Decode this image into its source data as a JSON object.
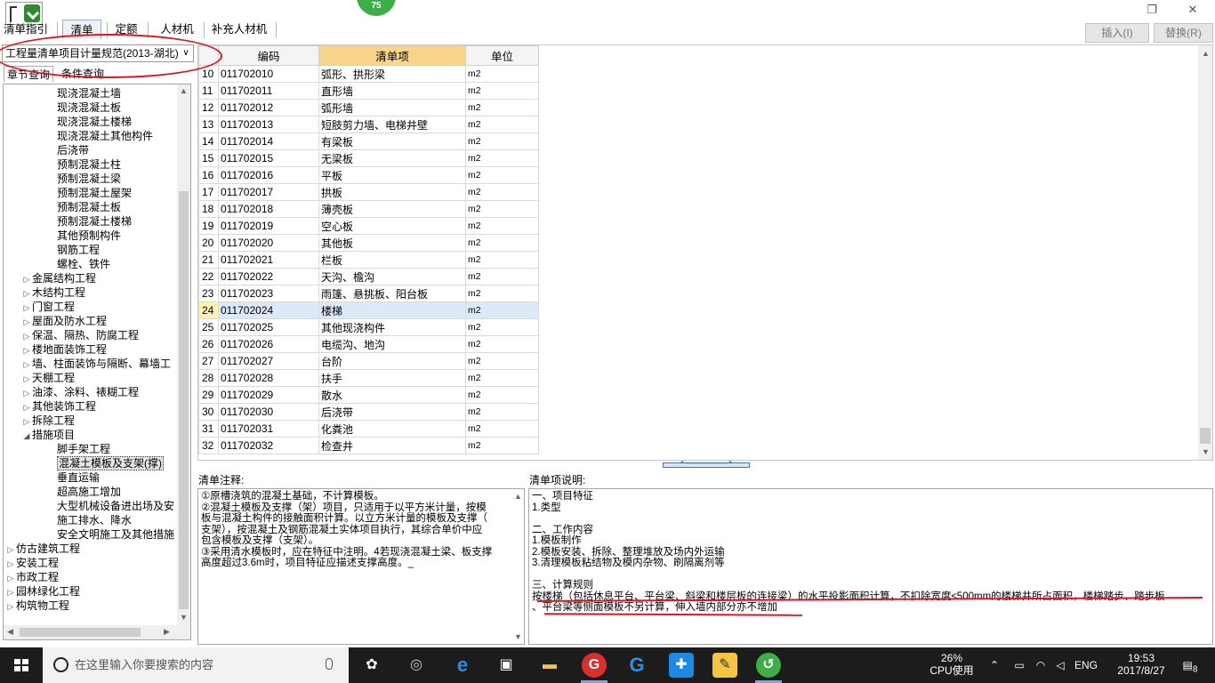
{
  "window": {
    "badge": "75",
    "restore_glyph": "❐",
    "close_glyph": "✕"
  },
  "tabs": [
    "清单指引",
    "清单",
    "定额",
    "人材机",
    "补充人材机"
  ],
  "toolbar": {
    "insert": "插入(I)",
    "replace": "替换(R)"
  },
  "left": {
    "spec_select": "工程量清单项目计量规范(2013-湖北)",
    "search_tabs": [
      "章节查询",
      "条件查询"
    ],
    "tree": [
      {
        "label": "现浇混凝土墙",
        "level": 3
      },
      {
        "label": "现浇混凝土板",
        "level": 3
      },
      {
        "label": "现浇混凝土楼梯",
        "level": 3
      },
      {
        "label": "现浇混凝土其他构件",
        "level": 3
      },
      {
        "label": "后浇带",
        "level": 3
      },
      {
        "label": "预制混凝土柱",
        "level": 3
      },
      {
        "label": "预制混凝土梁",
        "level": 3
      },
      {
        "label": "预制混凝土屋架",
        "level": 3
      },
      {
        "label": "预制混凝土板",
        "level": 3
      },
      {
        "label": "预制混凝土楼梯",
        "level": 3
      },
      {
        "label": "其他预制构件",
        "level": 3
      },
      {
        "label": "钢筋工程",
        "level": 3
      },
      {
        "label": "螺栓、铁件",
        "level": 3
      },
      {
        "label": "金属结构工程",
        "level": 2,
        "toggle": "▷"
      },
      {
        "label": "木结构工程",
        "level": 2,
        "toggle": "▷"
      },
      {
        "label": "门窗工程",
        "level": 2,
        "toggle": "▷"
      },
      {
        "label": "屋面及防水工程",
        "level": 2,
        "toggle": "▷"
      },
      {
        "label": "保温、隔热、防腐工程",
        "level": 2,
        "toggle": "▷"
      },
      {
        "label": "楼地面装饰工程",
        "level": 2,
        "toggle": "▷"
      },
      {
        "label": "墙、柱面装饰与隔断、幕墙工",
        "level": 2,
        "toggle": "▷"
      },
      {
        "label": "天棚工程",
        "level": 2,
        "toggle": "▷"
      },
      {
        "label": "油漆、涂料、裱糊工程",
        "level": 2,
        "toggle": "▷"
      },
      {
        "label": "其他装饰工程",
        "level": 2,
        "toggle": "▷"
      },
      {
        "label": "拆除工程",
        "level": 2,
        "toggle": "▷"
      },
      {
        "label": "措施项目",
        "level": 2,
        "toggle": "◢"
      },
      {
        "label": "脚手架工程",
        "level": 3
      },
      {
        "label": "混凝土模板及支架(撑)",
        "level": 3,
        "selected": true
      },
      {
        "label": "垂直运输",
        "level": 3
      },
      {
        "label": "超高施工增加",
        "level": 3
      },
      {
        "label": "大型机械设备进出场及安",
        "level": 3
      },
      {
        "label": "施工排水、降水",
        "level": 3
      },
      {
        "label": "安全文明施工及其他措施",
        "level": 3
      },
      {
        "label": "仿古建筑工程",
        "level": 1,
        "toggle": "▷"
      },
      {
        "label": "安装工程",
        "level": 1,
        "toggle": "▷"
      },
      {
        "label": "市政工程",
        "level": 1,
        "toggle": "▷"
      },
      {
        "label": "园林绿化工程",
        "level": 1,
        "toggle": "▷"
      },
      {
        "label": "构筑物工程",
        "level": 1,
        "toggle": "▷"
      }
    ]
  },
  "grid": {
    "headers": [
      "",
      "编码",
      "清单项",
      "单位"
    ],
    "rows": [
      [
        "10",
        "011702010",
        "弧形、拱形梁",
        "m2"
      ],
      [
        "11",
        "011702011",
        "直形墙",
        "m2"
      ],
      [
        "12",
        "011702012",
        "弧形墙",
        "m2"
      ],
      [
        "13",
        "011702013",
        "短肢剪力墙、电梯井壁",
        "m2"
      ],
      [
        "14",
        "011702014",
        "有梁板",
        "m2"
      ],
      [
        "15",
        "011702015",
        "无梁板",
        "m2"
      ],
      [
        "16",
        "011702016",
        "平板",
        "m2"
      ],
      [
        "17",
        "011702017",
        "拱板",
        "m2"
      ],
      [
        "18",
        "011702018",
        "薄壳板",
        "m2"
      ],
      [
        "19",
        "011702019",
        "空心板",
        "m2"
      ],
      [
        "20",
        "011702020",
        "其他板",
        "m2"
      ],
      [
        "21",
        "011702021",
        "栏板",
        "m2"
      ],
      [
        "22",
        "011702022",
        "天沟、檐沟",
        "m2"
      ],
      [
        "23",
        "011702023",
        "雨篷、悬挑板、阳台板",
        "m2"
      ],
      [
        "24",
        "011702024",
        "楼梯",
        "m2"
      ],
      [
        "25",
        "011702025",
        "其他现浇构件",
        "m2"
      ],
      [
        "26",
        "011702026",
        "电缆沟、地沟",
        "m2"
      ],
      [
        "27",
        "011702027",
        "台阶",
        "m2"
      ],
      [
        "28",
        "011702028",
        "扶手",
        "m2"
      ],
      [
        "29",
        "011702029",
        "散水",
        "m2"
      ],
      [
        "30",
        "011702030",
        "后浇带",
        "m2"
      ],
      [
        "31",
        "011702031",
        "化粪池",
        "m2"
      ],
      [
        "32",
        "011702032",
        "检查井",
        "m2"
      ]
    ],
    "selected_row": "24"
  },
  "notes": {
    "title": "清单注释:",
    "lines": [
      "①原槽浇筑的混凝土基础，不计算模板。",
      "②混凝土模板及支撑（架）项目，只适用于以平方米计量，按模",
      "板与混凝土构件的接触面积计算。以立方米计量的模板及支撑（",
      "支架），按混凝土及钢筋混凝土实体项目执行，其综合单价中应",
      "包含模板及支撑（支架）。",
      "③采用清水模板时，应在特征中注明。4若现浇混凝土梁、板支撑",
      "高度超过3.6m时，项目特征应描述支撑高度。_"
    ]
  },
  "explain": {
    "title": "清单项说明:",
    "lines": [
      "一、项目特征",
      "1.类型",
      "",
      "二、工作内容",
      "1.模板制作",
      "2.模板安装、拆除、整理堆放及场内外运输",
      "3.清理模板粘结物及模内杂物、刷隔离剂等",
      "",
      "三、计算规则",
      " 按楼梯（包括休息平台、平台梁、斜梁和楼层板的连接梁）的水平投影面积计算，不扣除宽度≤500mm的楼梯井所占面积，楼梯踏步、踏步板",
      "、平台梁等侧面模板不另计算，伸入墙内部分亦不增加"
    ]
  },
  "taskbar": {
    "search_placeholder": "在这里输入你要搜索的内容",
    "cpu_percent": "26%",
    "cpu_label": "CPU使用",
    "lang": "ENG",
    "time": "19:53",
    "date": "2017/8/27",
    "notification_count": "8"
  },
  "colors": {
    "annotation_red": "#e0151d",
    "selected_header": "#f8d58a",
    "selected_row": "#dbe9f8"
  }
}
